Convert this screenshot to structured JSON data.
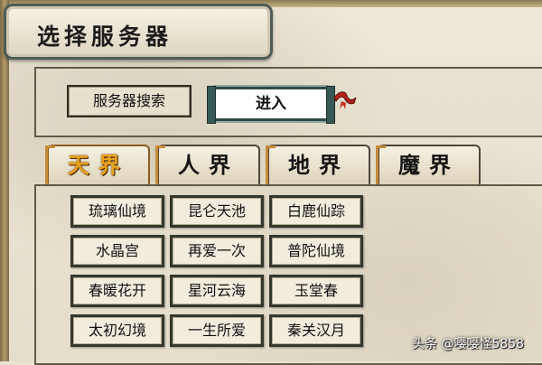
{
  "title": "选择服务器",
  "search": {
    "label": "服务器搜索",
    "enter_label": "进入"
  },
  "tabs": [
    {
      "label": "天界",
      "active": true
    },
    {
      "label": "人界",
      "active": false
    },
    {
      "label": "地界",
      "active": false
    },
    {
      "label": "魔界",
      "active": false
    }
  ],
  "servers": [
    [
      "琉璃仙境",
      "昆仑天池",
      "白鹿仙踪"
    ],
    [
      "水晶宫",
      "再爱一次",
      "普陀仙境"
    ],
    [
      "春暖花开",
      "星河云海",
      "玉堂春"
    ],
    [
      "太初幻境",
      "一生所爱",
      "秦关汉月"
    ]
  ],
  "watermark": "头条 @嘤嘤怪5858",
  "colors": {
    "active_tab": "#e8a21c",
    "panel_border": "#615a49",
    "button_border": "#33382e"
  }
}
